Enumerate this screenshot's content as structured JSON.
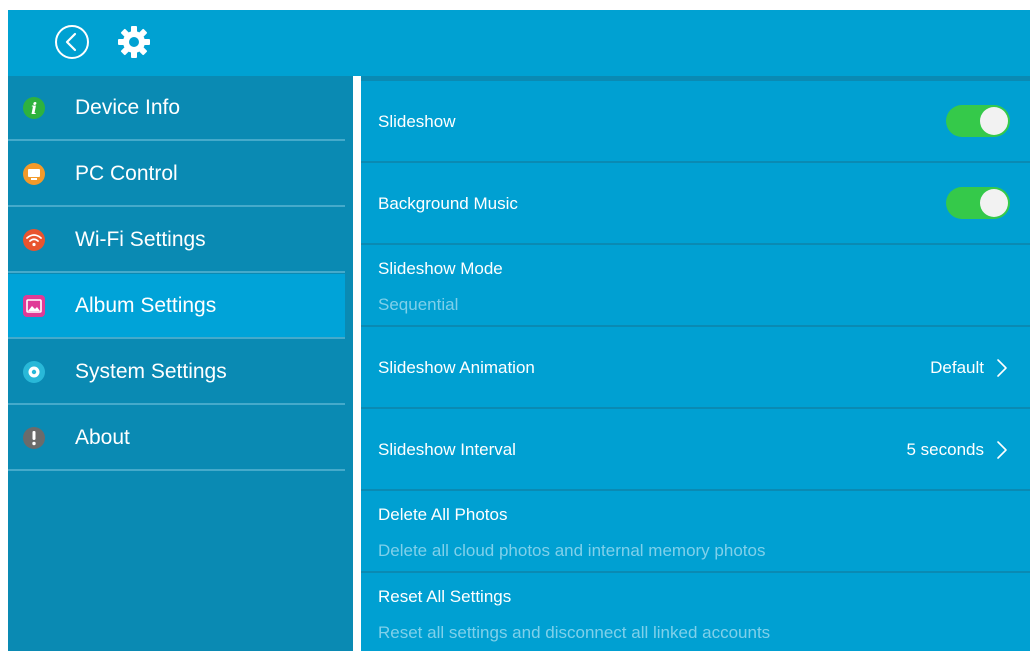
{
  "header": {
    "back_icon": "back-arrow-icon",
    "settings_icon": "gear-icon"
  },
  "sidebar": {
    "items": [
      {
        "label": "Device Info",
        "icon": "info-icon",
        "color": "#2eb23e",
        "active": false
      },
      {
        "label": "PC Control",
        "icon": "monitor-icon",
        "color": "#f39a2a",
        "active": false
      },
      {
        "label": "Wi-Fi Settings",
        "icon": "wifi-icon",
        "color": "#e8542e",
        "active": false
      },
      {
        "label": "Album Settings",
        "icon": "photo-icon",
        "color": "#e03a96",
        "active": true
      },
      {
        "label": "System Settings",
        "icon": "gear-icon",
        "color": "#29b8d8",
        "active": false
      },
      {
        "label": "About",
        "icon": "exclamation-icon",
        "color": "#6b6b6b",
        "active": false
      }
    ]
  },
  "settings": {
    "slideshow": {
      "title": "Slideshow",
      "enabled": true
    },
    "background_music": {
      "title": "Background Music",
      "enabled": true
    },
    "slideshow_mode": {
      "title": "Slideshow Mode",
      "value": "Sequential"
    },
    "slideshow_animation": {
      "title": "Slideshow Animation",
      "value": "Default"
    },
    "slideshow_interval": {
      "title": "Slideshow Interval",
      "value": "5 seconds"
    },
    "delete_all_photos": {
      "title": "Delete All Photos",
      "subtitle": "Delete all cloud photos and internal memory photos"
    },
    "reset_all_settings": {
      "title": "Reset All Settings",
      "subtitle": "Reset all settings and disconnect all linked accounts"
    }
  },
  "colors": {
    "topbar": "#00a1d2",
    "sidebar": "#0a8ab3",
    "row": "#00a0d2",
    "toggle_on": "#35c94a",
    "subtitle": "#7fd0ea"
  }
}
